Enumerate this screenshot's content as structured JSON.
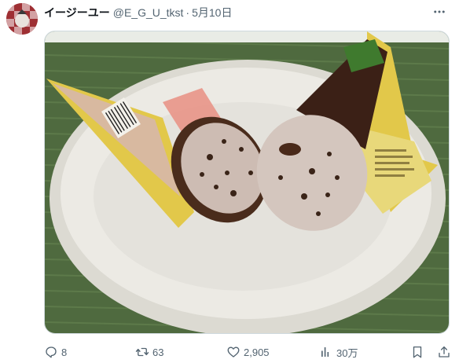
{
  "tweet": {
    "display_name": "イージーユー",
    "handle": "@E_G_U_tkst",
    "separator": "·",
    "date": "5月10日"
  },
  "actions": {
    "reply_count": "8",
    "retweet_count": "63",
    "like_count": "2,905",
    "view_count": "30万"
  },
  "icons": [
    "more-icon",
    "reply-icon",
    "retweet-icon",
    "like-icon",
    "views-icon",
    "bookmark-icon",
    "share-icon"
  ],
  "colors": {
    "text": "#0f1419",
    "secondary": "#536471",
    "border": "#cfd9de"
  }
}
